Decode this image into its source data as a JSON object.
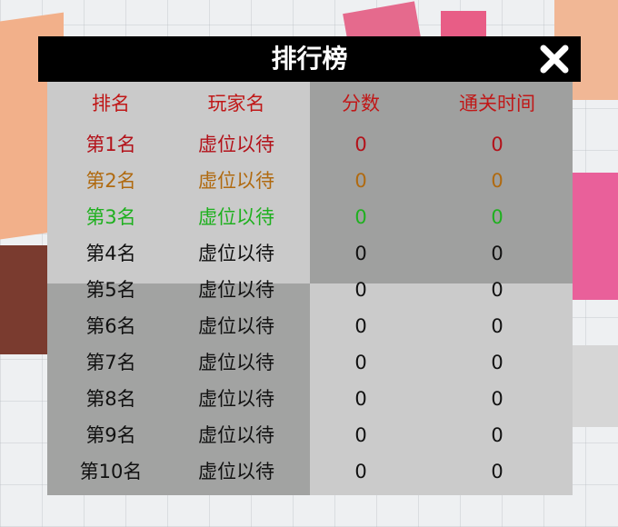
{
  "leaderboard": {
    "title": "排行榜",
    "columns": [
      "排名",
      "玩家名",
      "分数",
      "通关时间"
    ],
    "rows": [
      {
        "rank": "第1名",
        "player": "虚位以待",
        "score": "0",
        "time": "0",
        "color": "#b3121a"
      },
      {
        "rank": "第2名",
        "player": "虚位以待",
        "score": "0",
        "time": "0",
        "color": "#b06a10"
      },
      {
        "rank": "第3名",
        "player": "虚位以待",
        "score": "0",
        "time": "0",
        "color": "#1fb01f"
      },
      {
        "rank": "第4名",
        "player": "虚位以待",
        "score": "0",
        "time": "0",
        "color": "#111111"
      },
      {
        "rank": "第5名",
        "player": "虚位以待",
        "score": "0",
        "time": "0",
        "color": "#111111"
      },
      {
        "rank": "第6名",
        "player": "虚位以待",
        "score": "0",
        "time": "0",
        "color": "#111111"
      },
      {
        "rank": "第7名",
        "player": "虚位以待",
        "score": "0",
        "time": "0",
        "color": "#111111"
      },
      {
        "rank": "第8名",
        "player": "虚位以待",
        "score": "0",
        "time": "0",
        "color": "#111111"
      },
      {
        "rank": "第9名",
        "player": "虚位以待",
        "score": "0",
        "time": "0",
        "color": "#111111"
      },
      {
        "rank": "第10名",
        "player": "虚位以待",
        "score": "0",
        "time": "0",
        "color": "#111111"
      }
    ],
    "close_icon": "close-x-icon",
    "header_color": "#c01818"
  }
}
